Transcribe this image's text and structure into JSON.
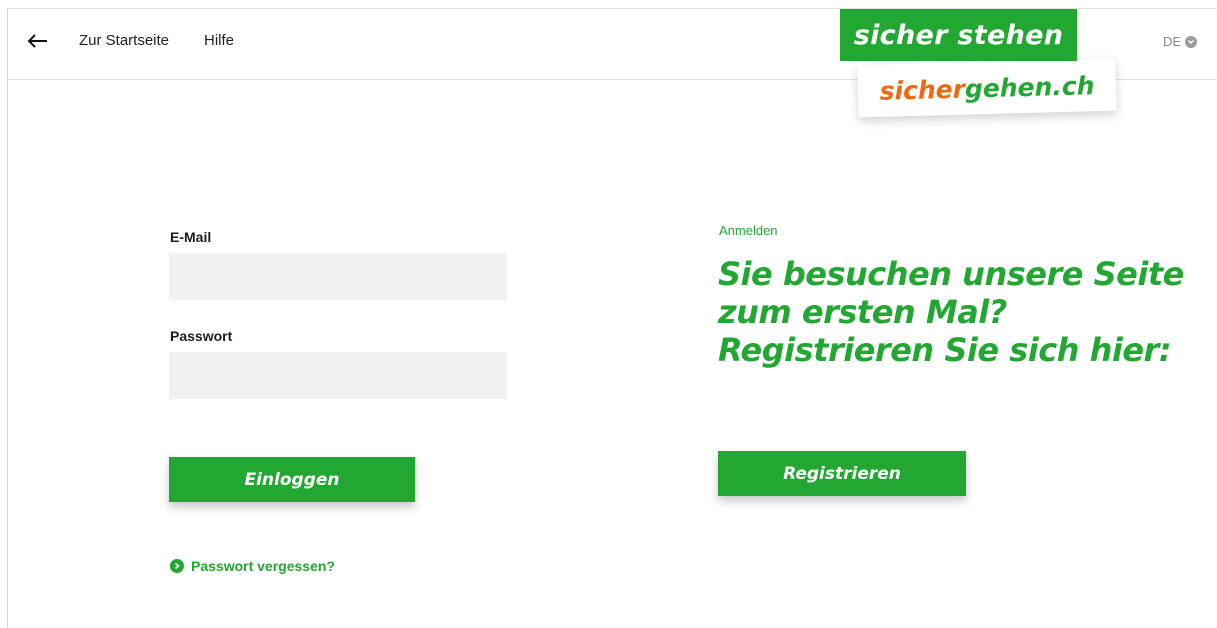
{
  "header": {
    "home_link": "Zur Startseite",
    "help_link": "Hilfe",
    "language": "DE"
  },
  "logo": {
    "top_text": "sicher stehen",
    "bottom_part1": "sicher",
    "bottom_part2": "gehen.ch"
  },
  "login": {
    "email_label": "E-Mail",
    "email_value": "",
    "password_label": "Passwort",
    "password_value": "",
    "submit_label": "Einloggen",
    "forgot_label": "Passwort vergessen?"
  },
  "register": {
    "kicker": "Anmelden",
    "headline": "Sie besuchen unsere Seite zum ersten Mal? Registrieren Sie sich hier:",
    "button_label": "Registrieren"
  },
  "colors": {
    "brand_green": "#22a832",
    "brand_orange": "#ec6a0f",
    "field_bg": "#f2f1f0"
  },
  "icons": [
    "arrow-left-icon",
    "chevron-down-icon",
    "chevron-right-circle-icon"
  ]
}
